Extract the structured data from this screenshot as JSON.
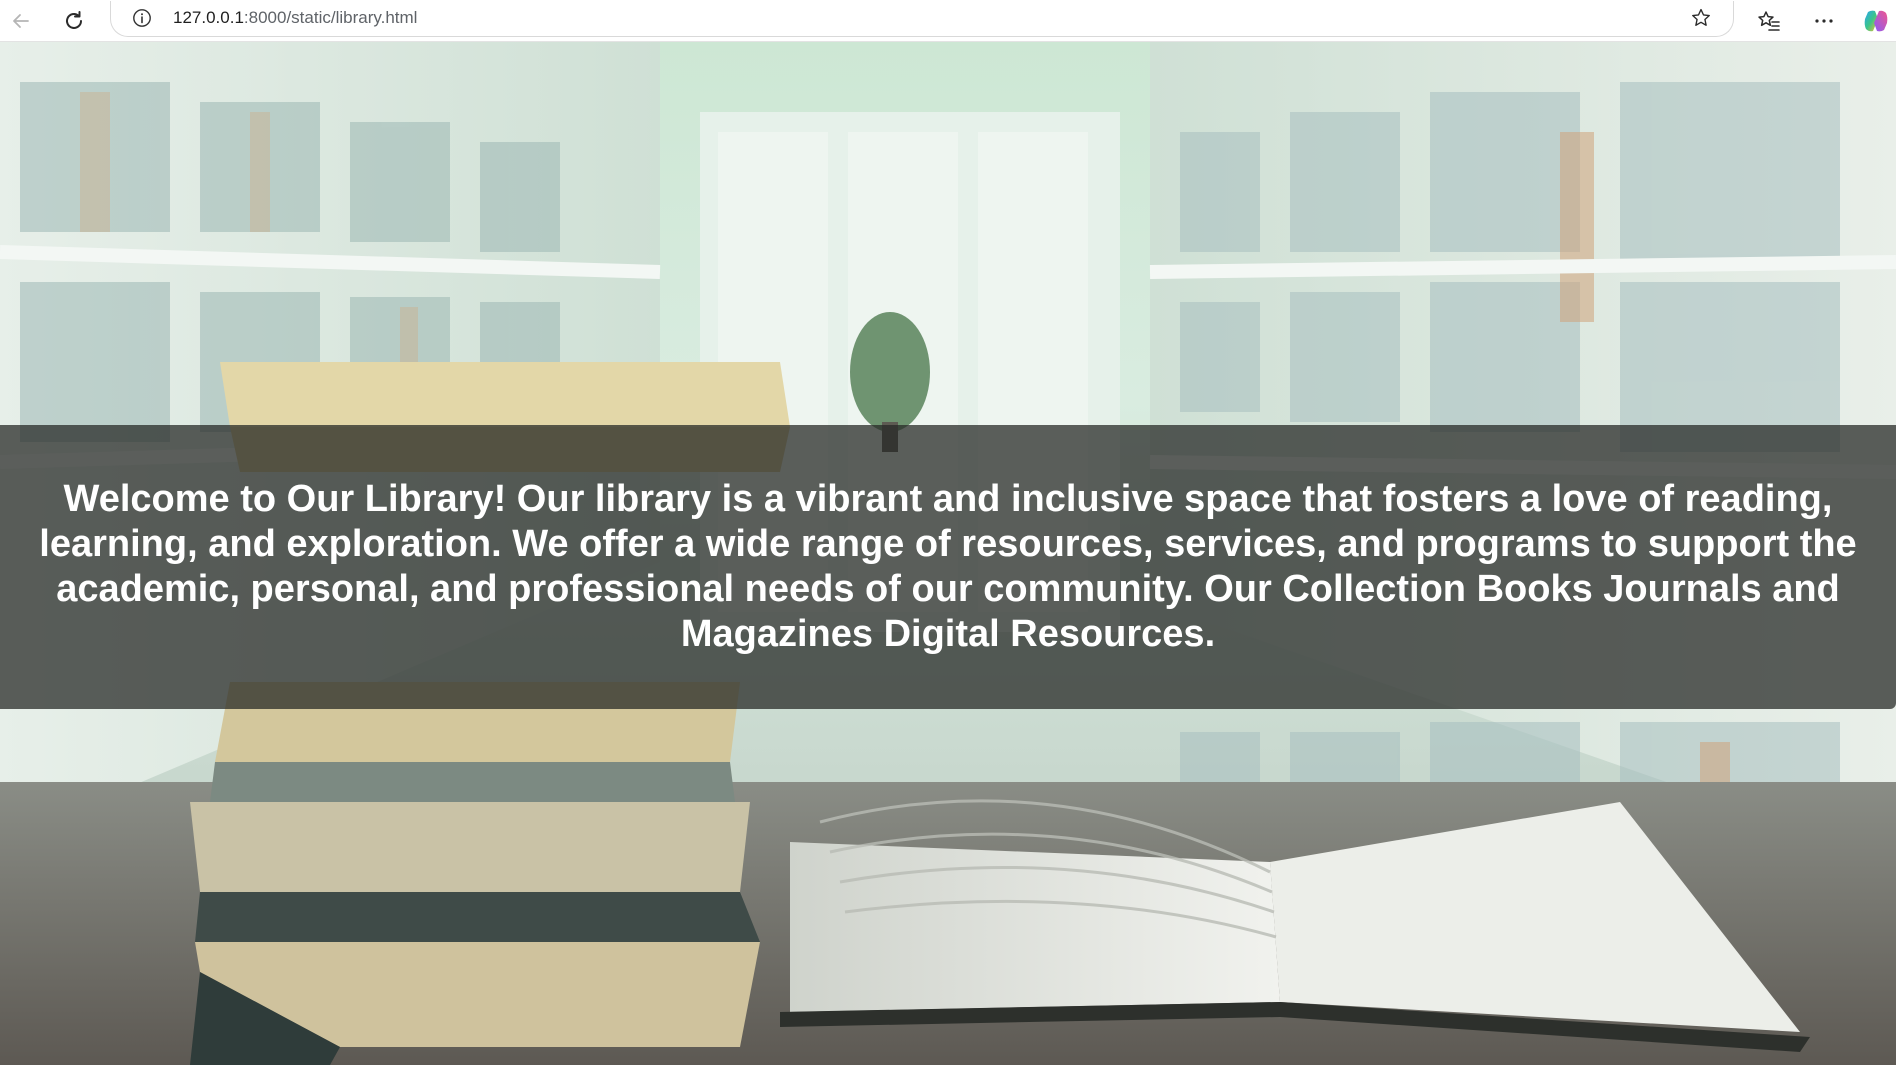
{
  "browser": {
    "url_host": "127.0.0.1",
    "url_path": ":8000/static/library.html",
    "icons": {
      "back": "back-arrow-icon",
      "reload": "reload-icon",
      "site_info": "info-icon",
      "favorite": "star-icon",
      "favorites": "favorites-icon",
      "menu": "more-icon",
      "copilot": "copilot-icon"
    }
  },
  "page": {
    "welcome_text": "Welcome to Our Library! Our library is a vibrant and inclusive space that fosters a love of reading, learning, and exploration. We offer a wide range of resources, services, and programs to support the academic, personal, and professional needs of our community. Our Collection Books Journals and Magazines Digital Resources.",
    "background_image": "library-books-photo",
    "colors": {
      "banner_overlay": "#262926",
      "text": "#ffffff"
    }
  }
}
